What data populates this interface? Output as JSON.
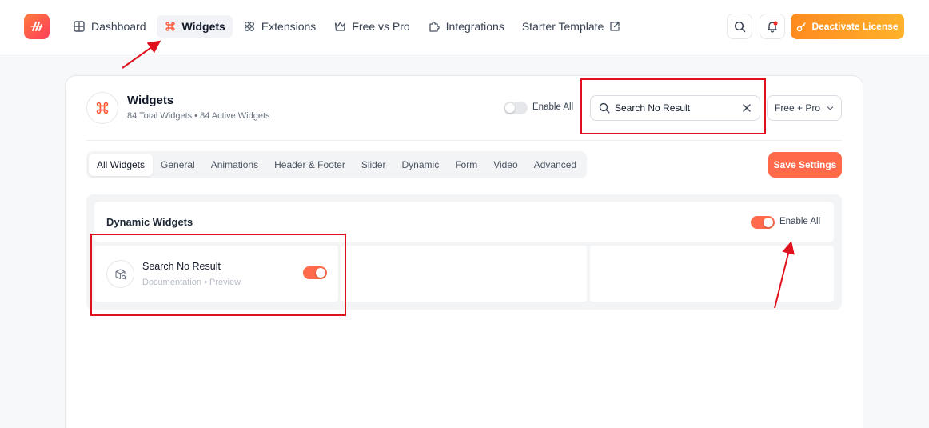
{
  "nav": {
    "items": [
      {
        "label": "Dashboard",
        "icon": "grid-icon"
      },
      {
        "label": "Widgets",
        "icon": "command-icon"
      },
      {
        "label": "Extensions",
        "icon": "extensions-icon"
      },
      {
        "label": "Free vs Pro",
        "icon": "crown-icon"
      },
      {
        "label": "Integrations",
        "icon": "puzzle-icon"
      },
      {
        "label": "Starter Template",
        "icon": "external-link-icon"
      }
    ],
    "active": "Widgets",
    "license_button": "Deactivate License"
  },
  "widgets_header": {
    "title": "Widgets",
    "subtitle": "84 Total Widgets • 84 Active Widgets",
    "enable_all_label": "Enable All",
    "search_value": "Search No Result",
    "plan_filter": "Free + Pro"
  },
  "tabs": [
    "All Widgets",
    "General",
    "Animations",
    "Header & Footer",
    "Slider",
    "Dynamic",
    "Form",
    "Video",
    "Advanced"
  ],
  "active_tab": "All Widgets",
  "save_button": "Save Settings",
  "section": {
    "title": "Dynamic Widgets",
    "enable_all_label": "Enable All",
    "enable_all_on": true
  },
  "widget": {
    "name": "Search No Result",
    "doc_link": "Documentation",
    "separator": "•",
    "preview_link": "Preview",
    "enabled": true
  },
  "colors": {
    "accent": "#ff6b4a",
    "license_gradient": [
      "#ff8a1f",
      "#ffb22b"
    ],
    "highlight": "#e0101c"
  }
}
